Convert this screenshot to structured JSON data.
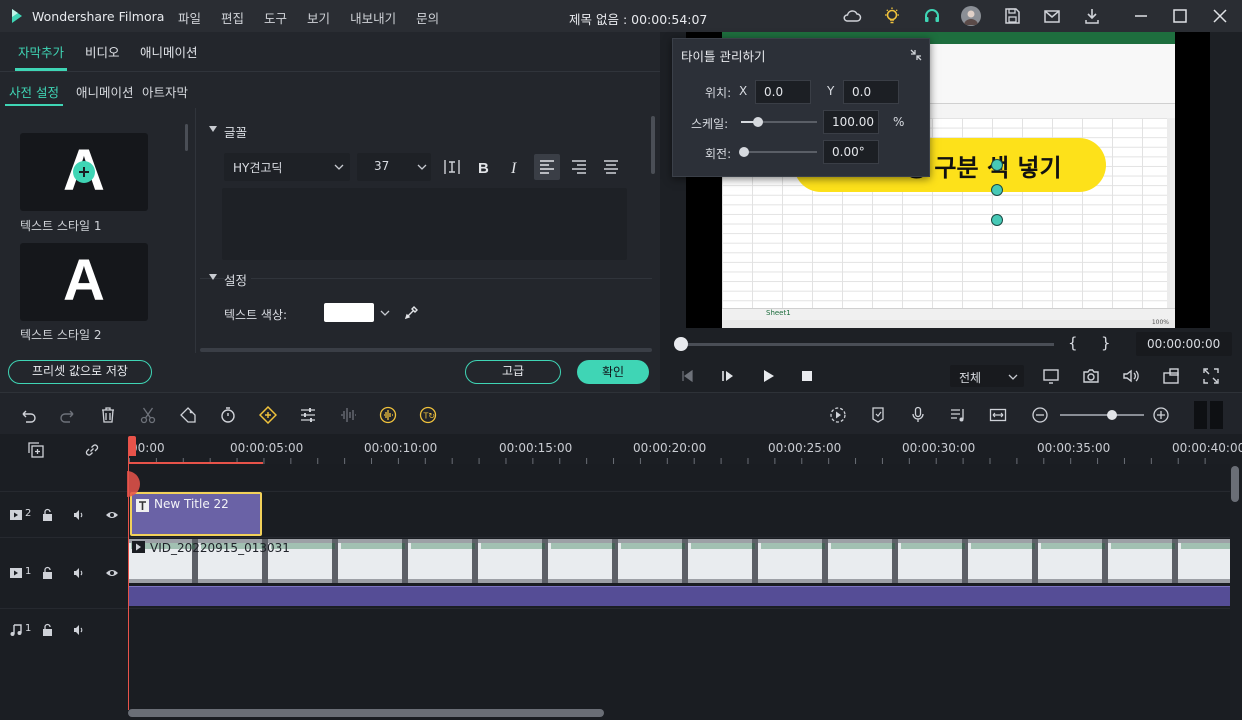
{
  "app": {
    "name": "Wondershare Filmora",
    "menu": [
      "파일",
      "편집",
      "도구",
      "보기",
      "내보내기",
      "문의"
    ],
    "document_title": "제목 없음 : 00:00:54:07"
  },
  "left_panel": {
    "top_tabs": [
      "자막추가",
      "비디오",
      "애니메이션"
    ],
    "sub_tabs": [
      "사전 설정",
      "애니메이션",
      "아트자막"
    ],
    "presets": [
      {
        "label": "텍스트 스타일 1",
        "glyph": "A"
      },
      {
        "label": "텍스트 스타일 2",
        "glyph": "A"
      }
    ],
    "font_section": {
      "header": "글꼴",
      "font_name": "HY견고딕",
      "font_size": "37"
    },
    "settings_section": {
      "header": "설정",
      "text_color_label": "텍스트 색상:"
    },
    "buttons": {
      "save_preset": "프리셋 값으로 저장",
      "advanced": "고급",
      "confirm": "확인"
    }
  },
  "title_manager": {
    "title": "타이틀 관리하기",
    "position_label": "위치:",
    "x_label": "X",
    "x_value": "0.0",
    "y_label": "Y",
    "y_value": "0.0",
    "scale_label": "스케일:",
    "scale_value": "100.00",
    "scale_unit": "%",
    "scale_level_fraction": 0.23,
    "rotate_label": "회전:",
    "rotate_value": "0.00°"
  },
  "preview": {
    "overlay_text": "행 구분 색 넣기",
    "timecode": "00:00:00:00",
    "quality": "전체",
    "sheet_tab": "Sheet1",
    "zoom": "100%"
  },
  "timeline": {
    "ruler_labels": [
      "00:00",
      "00:00:05:00",
      "00:00:10:00",
      "00:00:15:00",
      "00:00:20:00",
      "00:00:25:00",
      "00:00:30:00",
      "00:00:35:00",
      "00:00:40:00"
    ],
    "tracks": [
      {
        "label": "2",
        "clip": "New Title 22"
      },
      {
        "label": "1",
        "clip": "VID_20220915_013031"
      },
      {
        "label": "1"
      }
    ]
  },
  "colors": {
    "accent": "#3fd5b5",
    "title_clip": "#6a62a6",
    "title_clip_border": "#f2d15a",
    "playhead": "#e8534a"
  }
}
